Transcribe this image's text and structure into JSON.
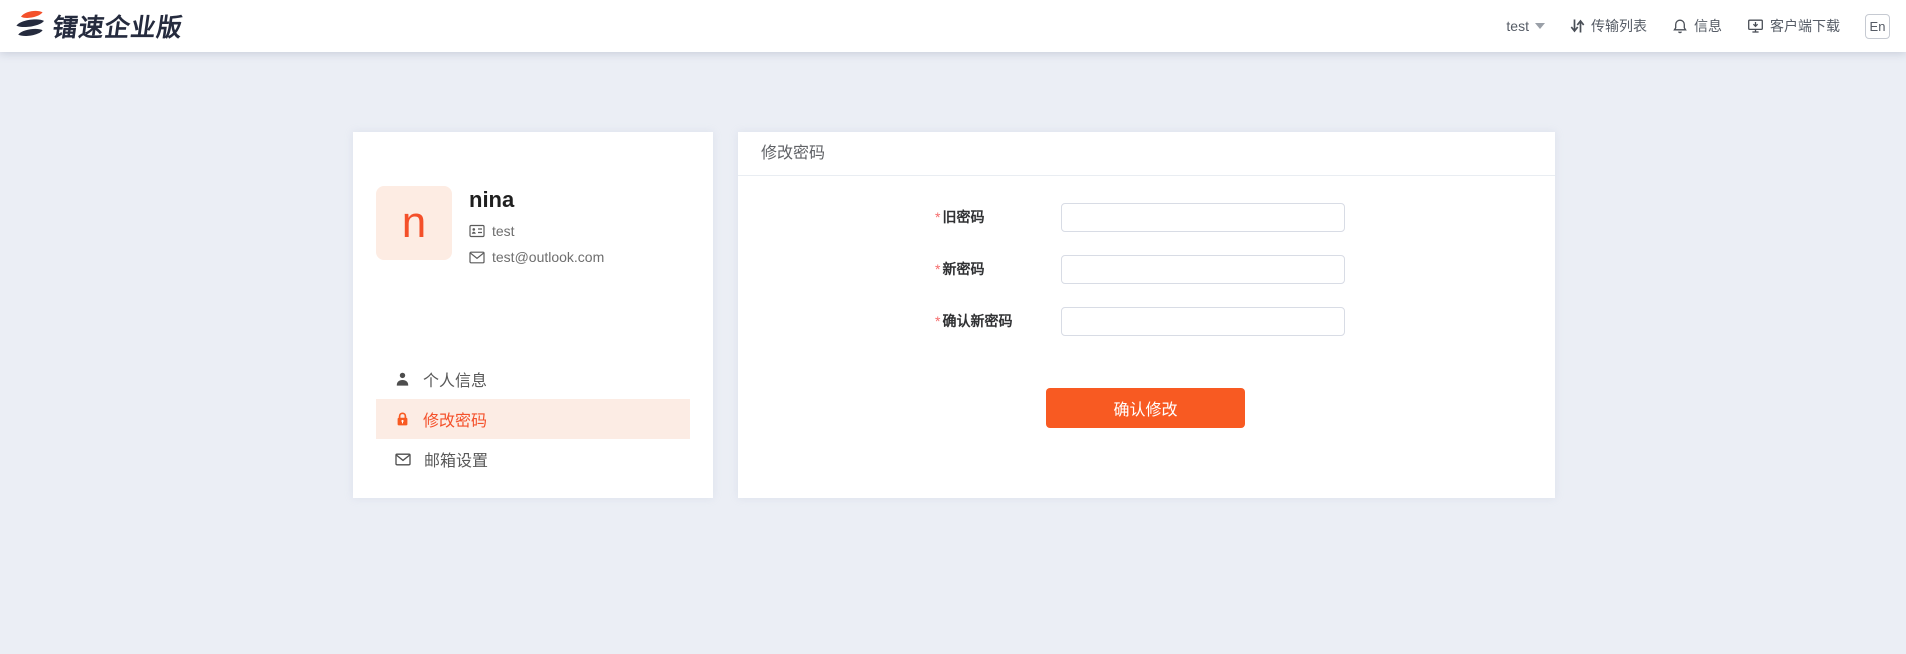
{
  "header": {
    "brand": "镭速企业版",
    "nav": {
      "user": "test",
      "transfer_list": "传输列表",
      "messages": "信息",
      "client_download": "客户端下载",
      "language": "En"
    }
  },
  "profile_card": {
    "avatar_letter": "n",
    "name": "nina",
    "username": "test",
    "email": "test@outlook.com",
    "menu": [
      {
        "label": "个人信息",
        "icon": "user-icon",
        "active": false
      },
      {
        "label": "修改密码",
        "icon": "lock-icon",
        "active": true
      },
      {
        "label": "邮箱设置",
        "icon": "mail-icon",
        "active": false
      }
    ]
  },
  "panel": {
    "title": "修改密码",
    "form": {
      "required_mark": "*",
      "fields": [
        {
          "label": "旧密码",
          "required": true,
          "value": ""
        },
        {
          "label": "新密码",
          "required": true,
          "value": ""
        },
        {
          "label": "确认新密码",
          "required": true,
          "value": ""
        }
      ],
      "submit_label": "确认修改"
    }
  },
  "colors": {
    "accent_orange": "#f85a22",
    "avatar_letter": "#f4502a",
    "avatar_bg": "#fdece3",
    "active_item_bg": "#fcece4",
    "page_bg": "#ebeef5",
    "brand_navy": "#252b3e",
    "required_red": "#f56c6c"
  }
}
